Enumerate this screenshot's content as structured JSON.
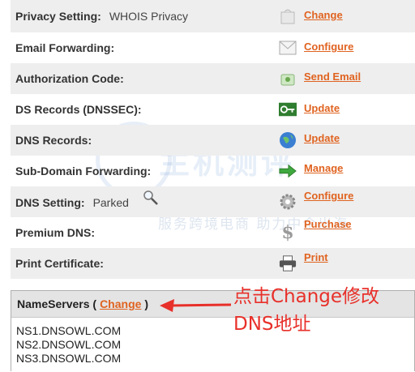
{
  "rows": [
    {
      "label": "Privacy Setting:",
      "value": "WHOIS Privacy",
      "action": "Change",
      "icon": "privacy-icon"
    },
    {
      "label": "Email Forwarding:",
      "value": "",
      "action": "Configure",
      "icon": "envelope-icon"
    },
    {
      "label": "Authorization Code:",
      "value": "",
      "action": "Send Email",
      "icon": "send-email-icon"
    },
    {
      "label": "DS Records (DNSSEC):",
      "value": "",
      "action": "Update",
      "icon": "key-icon"
    },
    {
      "label": "DNS Records:",
      "value": "",
      "action": "Update",
      "icon": "globe-icon"
    },
    {
      "label": "Sub-Domain Forwarding:",
      "value": "",
      "action": "Manage",
      "icon": "green-arrow-icon"
    },
    {
      "label": "DNS Setting:",
      "value": "Parked",
      "action": "Configure",
      "icon": "gear-icon"
    },
    {
      "label": "Premium DNS:",
      "value": "",
      "action": "Purchase",
      "icon": "dollar-icon"
    },
    {
      "label": "Print Certificate:",
      "value": "",
      "action": "Print",
      "icon": "printer-icon"
    }
  ],
  "nameservers": {
    "title": "NameServers (",
    "change_label": "Change",
    "close": ")",
    "list": [
      "NS1.DNSOWL.COM",
      "NS2.DNSOWL.COM",
      "NS3.DNSOWL.COM"
    ]
  },
  "annotation": {
    "line1": "点击Change修改",
    "line2": "DNS地址",
    "color": "#e8302a"
  },
  "watermark": {
    "brand": "主机测评",
    "tagline": "服务跨境电商 助力中企出海"
  },
  "colors": {
    "link": "#e06320",
    "alt_row": "#eeeeee"
  }
}
